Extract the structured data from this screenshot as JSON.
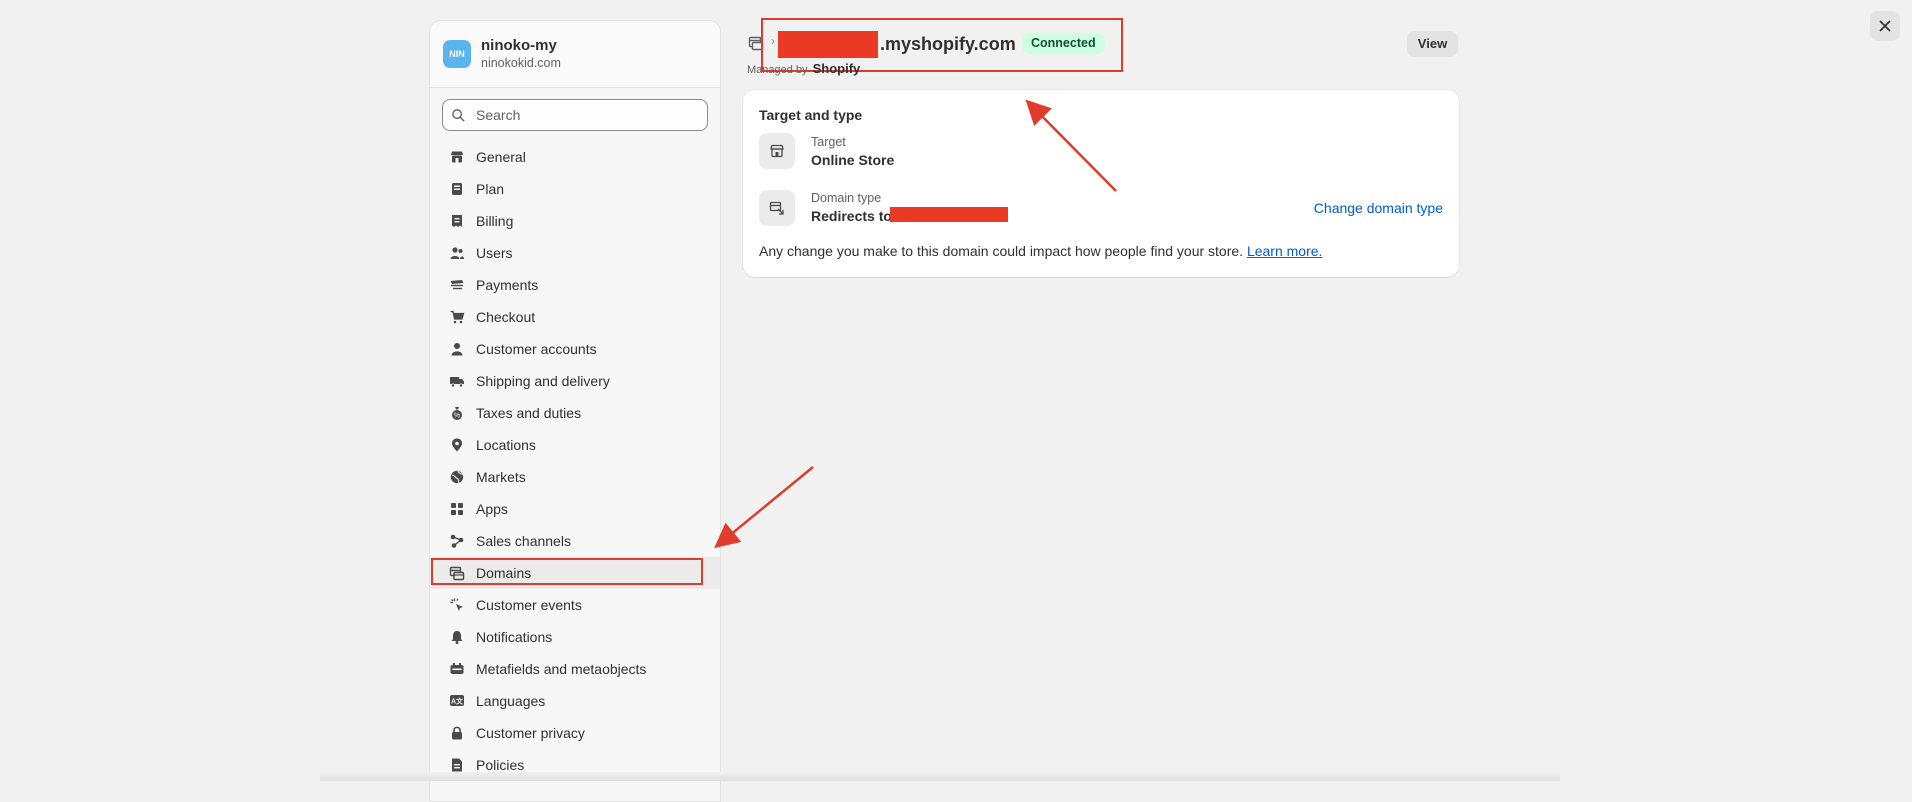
{
  "close_label": "×",
  "store": {
    "initials": "NIN",
    "name": "ninoko-my",
    "domain": "ninokokid.com"
  },
  "search": {
    "placeholder": "Search",
    "value": ""
  },
  "nav": [
    {
      "label": "General",
      "icon": "store-icon"
    },
    {
      "label": "Plan",
      "icon": "plan-icon"
    },
    {
      "label": "Billing",
      "icon": "receipt-icon"
    },
    {
      "label": "Users",
      "icon": "users-icon"
    },
    {
      "label": "Payments",
      "icon": "payments-icon"
    },
    {
      "label": "Checkout",
      "icon": "cart-icon"
    },
    {
      "label": "Customer accounts",
      "icon": "person-icon"
    },
    {
      "label": "Shipping and delivery",
      "icon": "truck-icon"
    },
    {
      "label": "Taxes and duties",
      "icon": "money-bag-icon"
    },
    {
      "label": "Locations",
      "icon": "pin-icon"
    },
    {
      "label": "Markets",
      "icon": "globe-icon"
    },
    {
      "label": "Apps",
      "icon": "apps-icon"
    },
    {
      "label": "Sales channels",
      "icon": "channels-icon"
    },
    {
      "label": "Domains",
      "icon": "domain-icon",
      "active": true
    },
    {
      "label": "Customer events",
      "icon": "cursor-click-icon"
    },
    {
      "label": "Notifications",
      "icon": "bell-icon"
    },
    {
      "label": "Metafields and metaobjects",
      "icon": "metafields-icon"
    },
    {
      "label": "Languages",
      "icon": "language-icon"
    },
    {
      "label": "Customer privacy",
      "icon": "lock-icon"
    },
    {
      "label": "Policies",
      "icon": "document-icon"
    }
  ],
  "header": {
    "title_suffix": ".myshopify.com",
    "status": "Connected",
    "managed_by_prefix": "Managed by",
    "managed_by_brand": "Shopify",
    "view_label": "View"
  },
  "card": {
    "title": "Target and type",
    "target_label": "Target",
    "target_value": "Online Store",
    "domain_type_label": "Domain type",
    "domain_type_value": "Redirects to",
    "change_link": "Change domain type",
    "footnote": "Any change you make to this domain could impact how people find your store.",
    "learn_more": "Learn more."
  },
  "colors": {
    "annotation": "#e03c2b",
    "redaction": "#e83a25",
    "badge_bg": "#cdfee1",
    "link": "#005bd3",
    "avatar": "#5ab4f0"
  }
}
